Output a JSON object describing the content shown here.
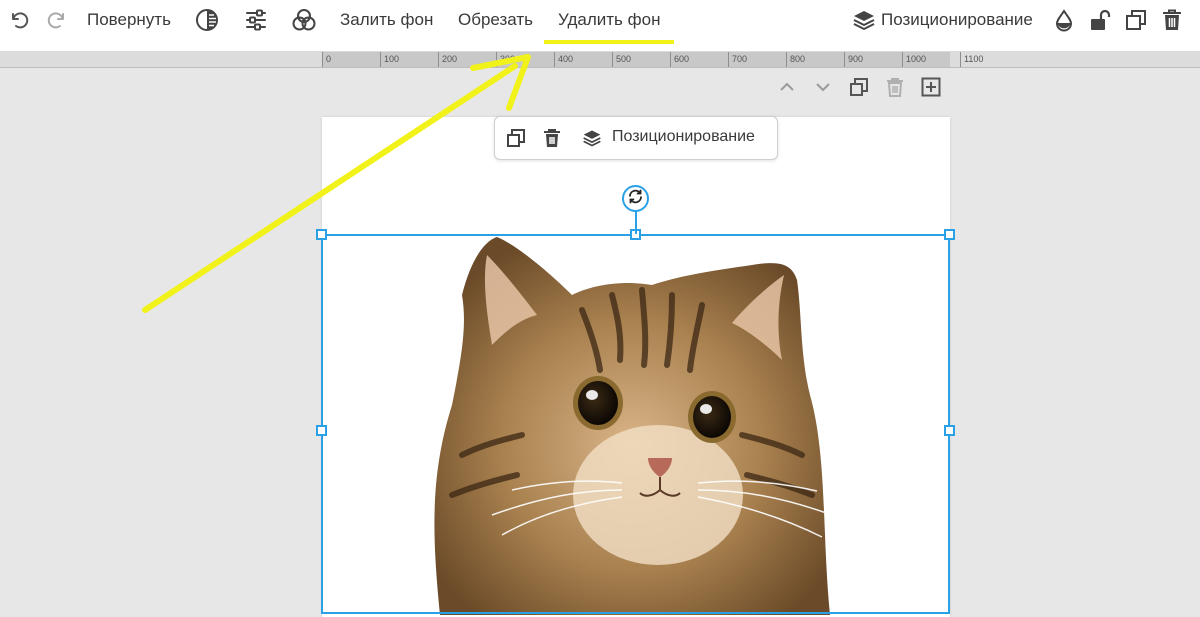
{
  "toolbar": {
    "rotate_label": "Повернуть",
    "fill_bg_label": "Залить фон",
    "crop_label": "Обрезать",
    "remove_bg_label": "Удалить фон",
    "positioning_label": "Позиционирование",
    "icons": [
      "undo-icon",
      "redo-icon",
      "filter-icon",
      "adjust-icon",
      "color-channels-icon",
      "layers-icon",
      "opacity-drop-icon",
      "unlock-icon",
      "duplicate-icon",
      "trash-icon"
    ]
  },
  "ruler": {
    "ticks": [
      "0",
      "100",
      "200",
      "300",
      "400",
      "500",
      "600",
      "700",
      "800",
      "900",
      "1000",
      "1100"
    ]
  },
  "float_toolbar": {
    "positioning_label": "Позиционирование"
  },
  "colors": {
    "selection": "#2aa1e6",
    "highlight": "#f2f21b",
    "canvas_bg": "#e7e7e7"
  }
}
